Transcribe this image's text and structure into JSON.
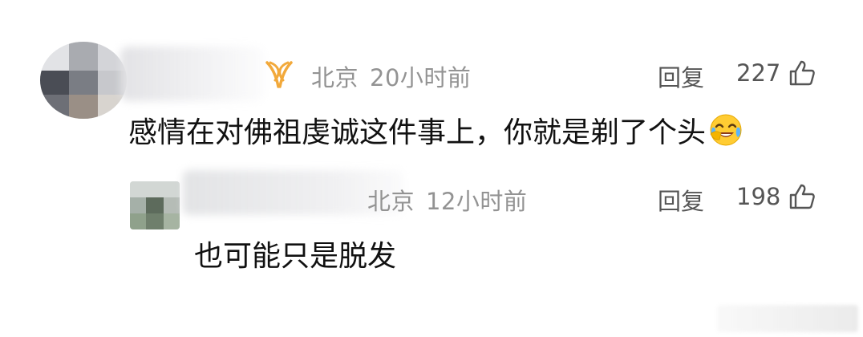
{
  "comments": [
    {
      "location": "北京",
      "time": "20小时前",
      "reply_label": "回复",
      "likes": "227",
      "text": "感情在对佛祖虔诚这件事上，你就是剃了个头",
      "emoji": "laughing-crying-emoji"
    },
    {
      "location": "北京",
      "time": "12小时前",
      "reply_label": "回复",
      "likes": "198",
      "text": "也可能只是脱发"
    }
  ],
  "colors": {
    "meta_text": "#939393",
    "action_text": "#555555",
    "body_text": "#111111",
    "vip_badge": "#f2a93b"
  }
}
